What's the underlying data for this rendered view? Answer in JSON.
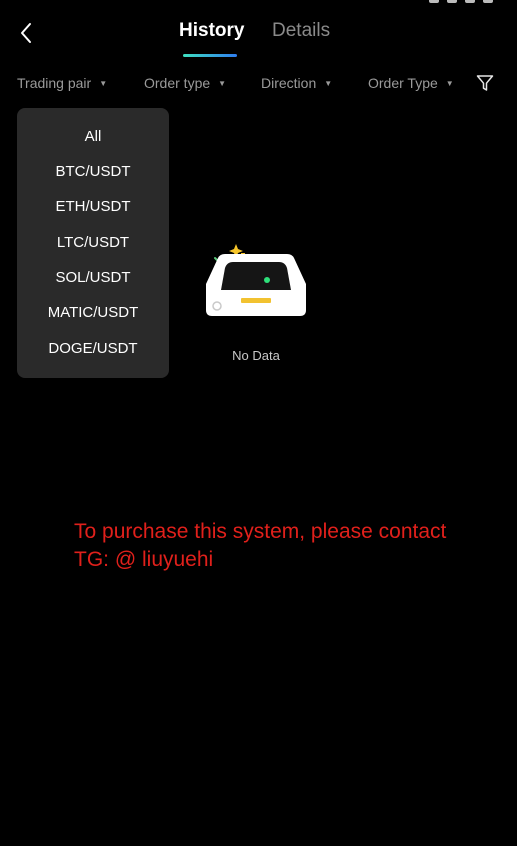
{
  "header": {
    "tabs": [
      {
        "label": "History",
        "active": true
      },
      {
        "label": "Details",
        "active": false
      }
    ]
  },
  "filters": [
    {
      "label": "Trading pair"
    },
    {
      "label": "Order type"
    },
    {
      "label": "Direction"
    },
    {
      "label": "Order Type"
    }
  ],
  "icons": {
    "back": "chevron-left-icon",
    "filter": "funnel-icon",
    "caret": "caret-down-icon",
    "empty": "empty-box-icon"
  },
  "dropdown": {
    "items": [
      "All",
      "BTC/USDT",
      "ETH/USDT",
      "LTC/USDT",
      "SOL/USDT",
      "MATIC/USDT",
      "DOGE/USDT"
    ]
  },
  "empty_state": {
    "text": "No Data"
  },
  "watermark": {
    "line1": "To purchase this system, please contact",
    "line2": "TG: @ liuyuehi"
  },
  "colors": {
    "background": "#000000",
    "dropdown_bg": "#2a2a2a",
    "accent_gradient_start": "#3ee0c0",
    "accent_gradient_end": "#2f7df0",
    "watermark": "#e0201b"
  }
}
